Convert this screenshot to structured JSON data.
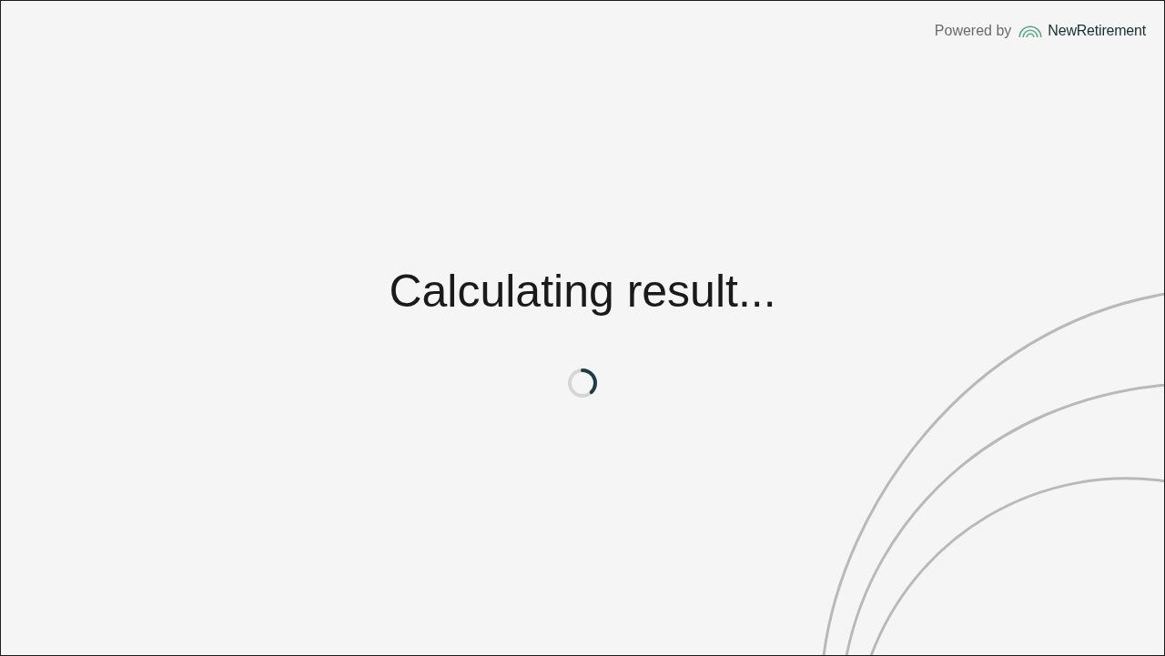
{
  "header": {
    "powered_by": "Powered by",
    "brand": "NewRetirement"
  },
  "loading": {
    "message": "Calculating result..."
  }
}
